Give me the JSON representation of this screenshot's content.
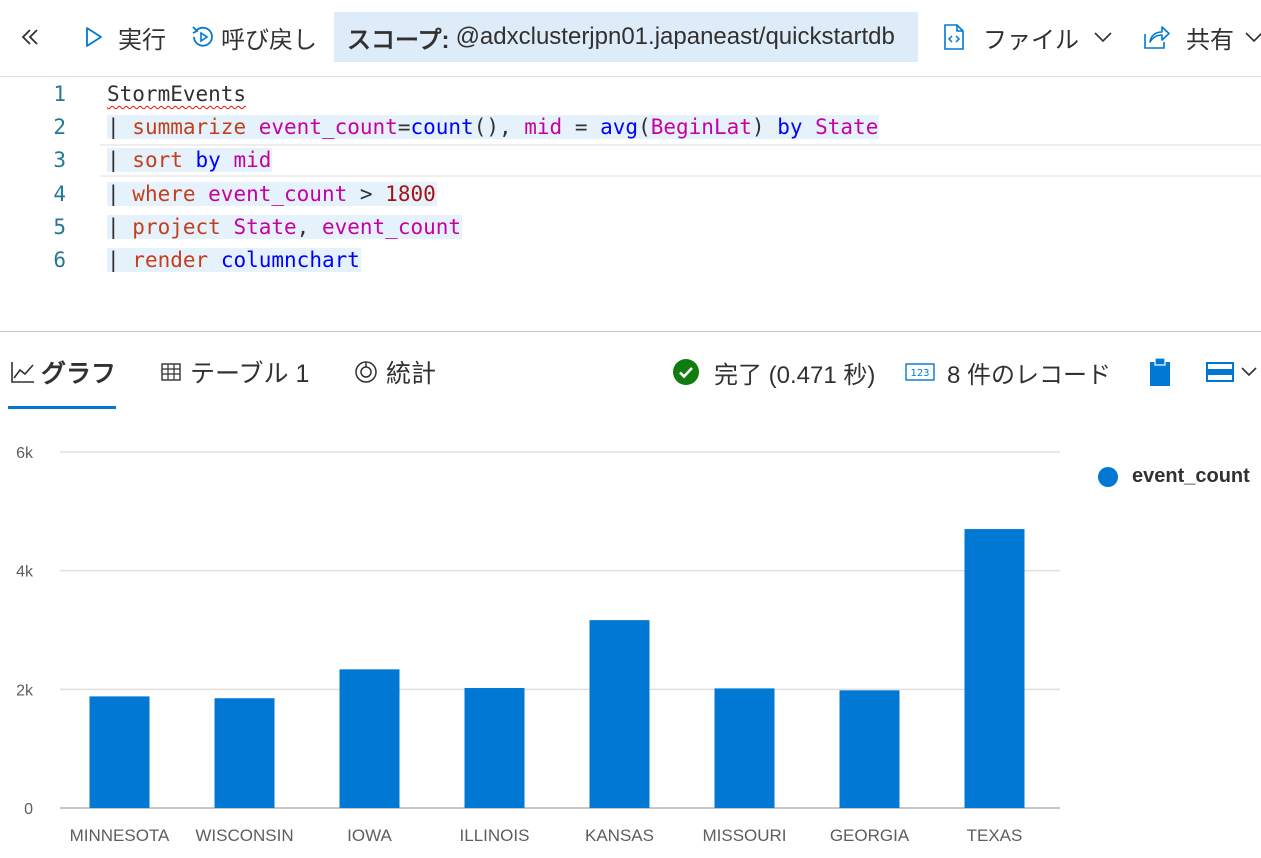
{
  "toolbar": {
    "run_label": "実行",
    "recall_label": "呼び戻し",
    "scope_label": "スコープ:",
    "scope_value": "@adxclusterjpn01.japaneast/quickstartdb",
    "file_label": "ファイル",
    "share_label": "共有"
  },
  "editor": {
    "lines": [
      {
        "num": "1",
        "tokens": [
          {
            "t": "StormEvents",
            "c": "tablename"
          }
        ]
      },
      {
        "num": "2",
        "tokens": [
          {
            "t": "| ",
            "c": "pipe"
          },
          {
            "t": "summarize ",
            "c": "kw"
          },
          {
            "t": "event_count",
            "c": "col"
          },
          {
            "t": "=",
            "c": "plain"
          },
          {
            "t": "count",
            "c": "fn"
          },
          {
            "t": "(), ",
            "c": "plain"
          },
          {
            "t": "mid",
            "c": "col"
          },
          {
            "t": " = ",
            "c": "plain"
          },
          {
            "t": "avg",
            "c": "fn"
          },
          {
            "t": "(",
            "c": "plain"
          },
          {
            "t": "BeginLat",
            "c": "col"
          },
          {
            "t": ") ",
            "c": "plain"
          },
          {
            "t": "by ",
            "c": "fn"
          },
          {
            "t": "State",
            "c": "col"
          }
        ]
      },
      {
        "num": "3",
        "tokens": [
          {
            "t": "| ",
            "c": "pipe"
          },
          {
            "t": "sort ",
            "c": "kw"
          },
          {
            "t": "by ",
            "c": "fn"
          },
          {
            "t": "mid",
            "c": "col"
          }
        ]
      },
      {
        "num": "4",
        "tokens": [
          {
            "t": "| ",
            "c": "pipe"
          },
          {
            "t": "where ",
            "c": "kw"
          },
          {
            "t": "event_count",
            "c": "col"
          },
          {
            "t": " > ",
            "c": "plain"
          },
          {
            "t": "1800",
            "c": "num"
          }
        ]
      },
      {
        "num": "5",
        "tokens": [
          {
            "t": "| ",
            "c": "pipe"
          },
          {
            "t": "project ",
            "c": "kw"
          },
          {
            "t": "State",
            "c": "col"
          },
          {
            "t": ", ",
            "c": "plain"
          },
          {
            "t": "event_count",
            "c": "col"
          }
        ]
      },
      {
        "num": "6",
        "tokens": [
          {
            "t": "| ",
            "c": "pipe"
          },
          {
            "t": "render ",
            "c": "kw"
          },
          {
            "t": "columnchart",
            "c": "fn"
          }
        ]
      }
    ]
  },
  "results": {
    "tab_chart": "グラフ",
    "tab_table": "テーブル 1",
    "tab_stats": "統計",
    "status_text": "完了 (0.471 秒)",
    "records_text": "8 件のレコード"
  },
  "colors": {
    "accent": "#0078d4",
    "success": "#107c10"
  },
  "chart_data": {
    "type": "bar",
    "categories": [
      "MINNESOTA",
      "WISCONSIN",
      "IOWA",
      "ILLINOIS",
      "KANSAS",
      "MISSOURI",
      "GEORGIA",
      "TEXAS"
    ],
    "series": [
      {
        "name": "event_count",
        "values": [
          1881,
          1850,
          2337,
          2022,
          3166,
          2016,
          1983,
          4701
        ]
      }
    ],
    "ylim": [
      0,
      6000
    ],
    "yticks": [
      0,
      2000,
      4000,
      6000
    ],
    "ytick_labels": [
      "0",
      "2k",
      "4k",
      "6k"
    ],
    "grid": true,
    "legend": "right"
  }
}
